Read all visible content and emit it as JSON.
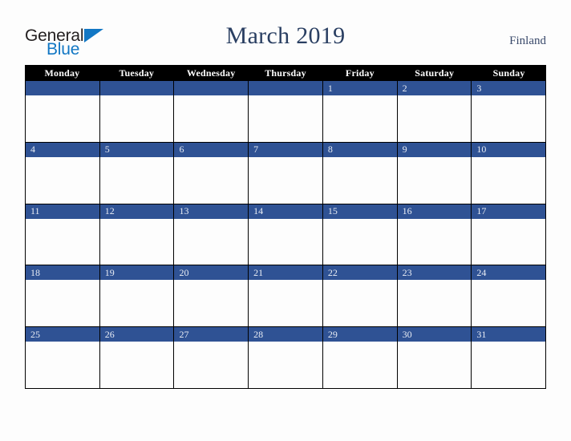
{
  "brand": {
    "name_part1": "General",
    "name_part2": "Blue",
    "triangle_color": "#1277c4",
    "text_color": "#231f20"
  },
  "header": {
    "title": "March 2019",
    "country": "Finland",
    "title_color": "#2a3f62",
    "country_color": "#3a4a6b"
  },
  "calendar": {
    "month": "March",
    "year": "2019",
    "accent_color": "#2f5294",
    "header_bg": "#000000",
    "header_text_color": "#ffffff",
    "day_number_color": "#e8ecf4",
    "weekdays": [
      "Monday",
      "Tuesday",
      "Wednesday",
      "Thursday",
      "Friday",
      "Saturday",
      "Sunday"
    ],
    "weeks": [
      [
        {
          "day": ""
        },
        {
          "day": ""
        },
        {
          "day": ""
        },
        {
          "day": ""
        },
        {
          "day": "1"
        },
        {
          "day": "2"
        },
        {
          "day": "3"
        }
      ],
      [
        {
          "day": "4"
        },
        {
          "day": "5"
        },
        {
          "day": "6"
        },
        {
          "day": "7"
        },
        {
          "day": "8"
        },
        {
          "day": "9"
        },
        {
          "day": "10"
        }
      ],
      [
        {
          "day": "11"
        },
        {
          "day": "12"
        },
        {
          "day": "13"
        },
        {
          "day": "14"
        },
        {
          "day": "15"
        },
        {
          "day": "16"
        },
        {
          "day": "17"
        }
      ],
      [
        {
          "day": "18"
        },
        {
          "day": "19"
        },
        {
          "day": "20"
        },
        {
          "day": "21"
        },
        {
          "day": "22"
        },
        {
          "day": "23"
        },
        {
          "day": "24"
        }
      ],
      [
        {
          "day": "25"
        },
        {
          "day": "26"
        },
        {
          "day": "27"
        },
        {
          "day": "28"
        },
        {
          "day": "29"
        },
        {
          "day": "30"
        },
        {
          "day": "31"
        }
      ]
    ]
  }
}
